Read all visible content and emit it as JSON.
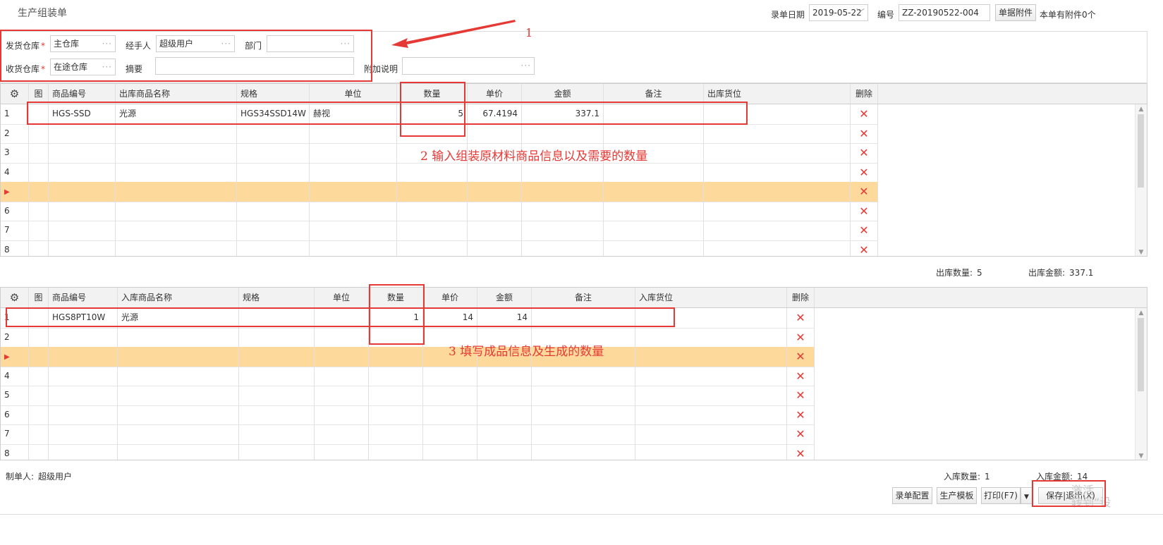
{
  "page": {
    "title": "生产组装单"
  },
  "header": {
    "date_label": "录单日期",
    "date_value": "2019-05-22",
    "number_label": "编号",
    "number_value": "ZZ-20190522-004",
    "attach_button": "单据附件",
    "attach_count": "本单有附件0个"
  },
  "form": {
    "ship_wh_label": "发货仓库",
    "ship_wh_value": "主仓库",
    "handler_label": "经手人",
    "handler_value": "超级用户",
    "dept_label": "部门",
    "dept_value": "",
    "recv_wh_label": "收货仓库",
    "recv_wh_value": "在途仓库",
    "summary_label": "摘要",
    "summary_value": "",
    "extra_label": "附加说明",
    "extra_value": "",
    "required_mark": "*",
    "dots": "···"
  },
  "out_grid": {
    "headers": [
      "图",
      "商品编号",
      "出库商品名称",
      "规格",
      "单位",
      "数量",
      "单价",
      "金额",
      "备注",
      "出库货位",
      "删除"
    ],
    "rows": [
      {
        "n": "1",
        "code": "HGS-SSD",
        "name": "光源",
        "spec": "HGS34SSD14W",
        "unit": "赫视",
        "qty": "5",
        "price": "67.4194",
        "amount": "337.1",
        "note": "",
        "loc": ""
      },
      {
        "n": "2"
      },
      {
        "n": "3"
      },
      {
        "n": "4"
      },
      {
        "n": "5",
        "selected": true
      },
      {
        "n": "6"
      },
      {
        "n": "7"
      },
      {
        "n": "8"
      }
    ]
  },
  "out_summary": {
    "qty_label": "出库数量:",
    "qty": "5",
    "amount_label": "出库金额:",
    "amount": "337.1"
  },
  "in_grid": {
    "headers": [
      "图",
      "商品编号",
      "入库商品名称",
      "规格",
      "单位",
      "数量",
      "单价",
      "金额",
      "备注",
      "入库货位",
      "删除"
    ],
    "rows": [
      {
        "n": "1",
        "code": "HGS8PT10W",
        "name": "光源",
        "spec": "",
        "unit": "",
        "qty": "1",
        "price": "14",
        "amount": "14",
        "note": "",
        "loc": ""
      },
      {
        "n": "2"
      },
      {
        "n": "3",
        "selected": true
      },
      {
        "n": "4"
      },
      {
        "n": "5"
      },
      {
        "n": "6"
      },
      {
        "n": "7"
      },
      {
        "n": "8"
      }
    ]
  },
  "in_summary": {
    "qty_label": "入库数量:",
    "qty": "1",
    "amount_label": "入库金额:",
    "amount": "14"
  },
  "footer": {
    "maker_label": "制单人:",
    "maker_value": "超级用户",
    "btn_config": "录单配置",
    "btn_template": "生产模板",
    "btn_print": "打印(F7)",
    "btn_save_exit": "保存|退出(X)"
  },
  "annotations": {
    "a1": "1",
    "a2": "2  输入组装原材料商品信息以及需要的数量",
    "a3": "3  填写成品信息及生成的数量",
    "watermark1": "激活",
    "watermark2": "转到“设"
  },
  "icons": {
    "gear": "gear-icon",
    "delete": "delete-x-icon",
    "row_pointer": "row-pointer-icon",
    "dropdown": "chevron-down-icon"
  },
  "colors": {
    "annotation_red": "#e53935",
    "selected_row": "#fdd99b",
    "header_bg": "#f2f2f2"
  }
}
